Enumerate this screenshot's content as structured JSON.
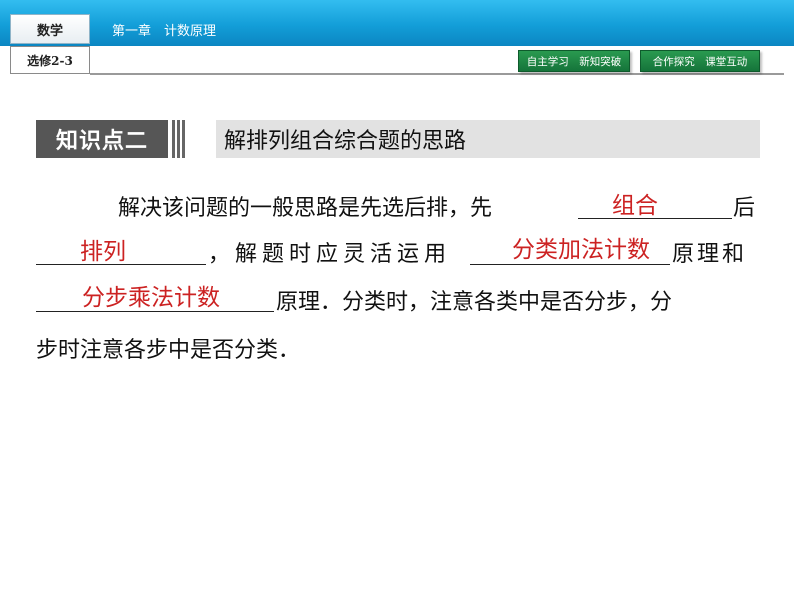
{
  "header": {
    "subject": "数学",
    "volume": "选修2-3",
    "chapter": "第一章　计数原理",
    "nav_buttons": [
      "自主学习　新知突破",
      "合作探究　课堂互动"
    ]
  },
  "knowledge_point": {
    "label": "知识点二",
    "title": "解排列组合综合题的思路"
  },
  "body": {
    "line1_text": "解决该问题的一般思路是先选后排，先",
    "line1_after": "后",
    "line2_mid": "，解题时应灵活运用",
    "line2_after": "原理和",
    "line3_after": "原理．分类时，注意各类中是否分步，分",
    "line4": "步时注意各步中是否分类．",
    "answers": [
      "组合",
      "排列",
      "分类加法计数",
      "分步乘法计数"
    ]
  },
  "colors": {
    "header_blue": "#139ed8",
    "nav_green": "#15743a",
    "answer_red": "#cc2222",
    "label_gray": "#565656"
  }
}
